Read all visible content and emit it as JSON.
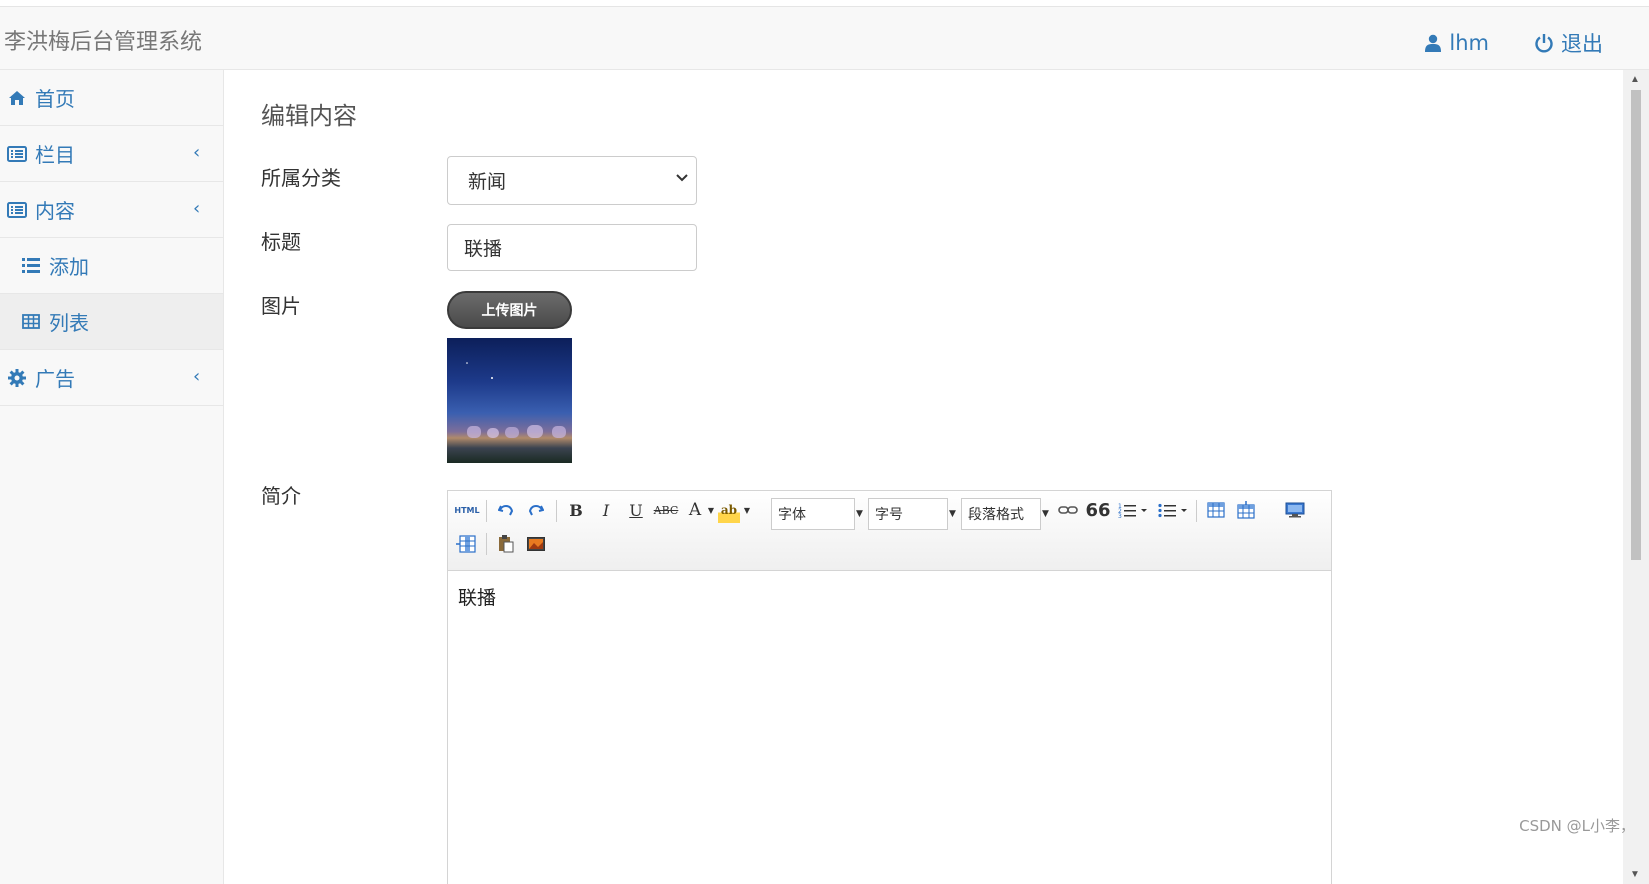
{
  "header": {
    "brand": "李洪梅后台管理系统",
    "user_label": "lhm",
    "logout_label": "退出"
  },
  "sidebar": {
    "items": [
      {
        "label": "首页",
        "icon": "home-icon"
      },
      {
        "label": "栏目",
        "icon": "list-alt-icon"
      },
      {
        "label": "内容",
        "icon": "list-alt-icon"
      },
      {
        "label": "添加",
        "icon": "list-icon"
      },
      {
        "label": "列表",
        "icon": "table-icon"
      },
      {
        "label": "广告",
        "icon": "gear-icon"
      }
    ]
  },
  "main": {
    "title": "编辑内容",
    "category_label": "所属分类",
    "category_value": "新闻",
    "title_label": "标题",
    "title_value": "联播",
    "image_label": "图片",
    "upload_label": "上传图片",
    "summary_label": "简介"
  },
  "editor": {
    "toolbar": {
      "html_label": "HTML",
      "bold": "B",
      "italic": "I",
      "underline": "U",
      "strike": "ABC",
      "fontcolor": "A",
      "highlight": "ab",
      "font_family": "字体",
      "font_size": "字号",
      "paragraph": "段落格式",
      "quote": "66"
    },
    "content": "联播"
  },
  "watermark": "CSDN @L小李，",
  "colors": {
    "link": "#337ab7",
    "sidebar_bg": "#f8f8f8",
    "active_bg": "#eeeeee"
  }
}
